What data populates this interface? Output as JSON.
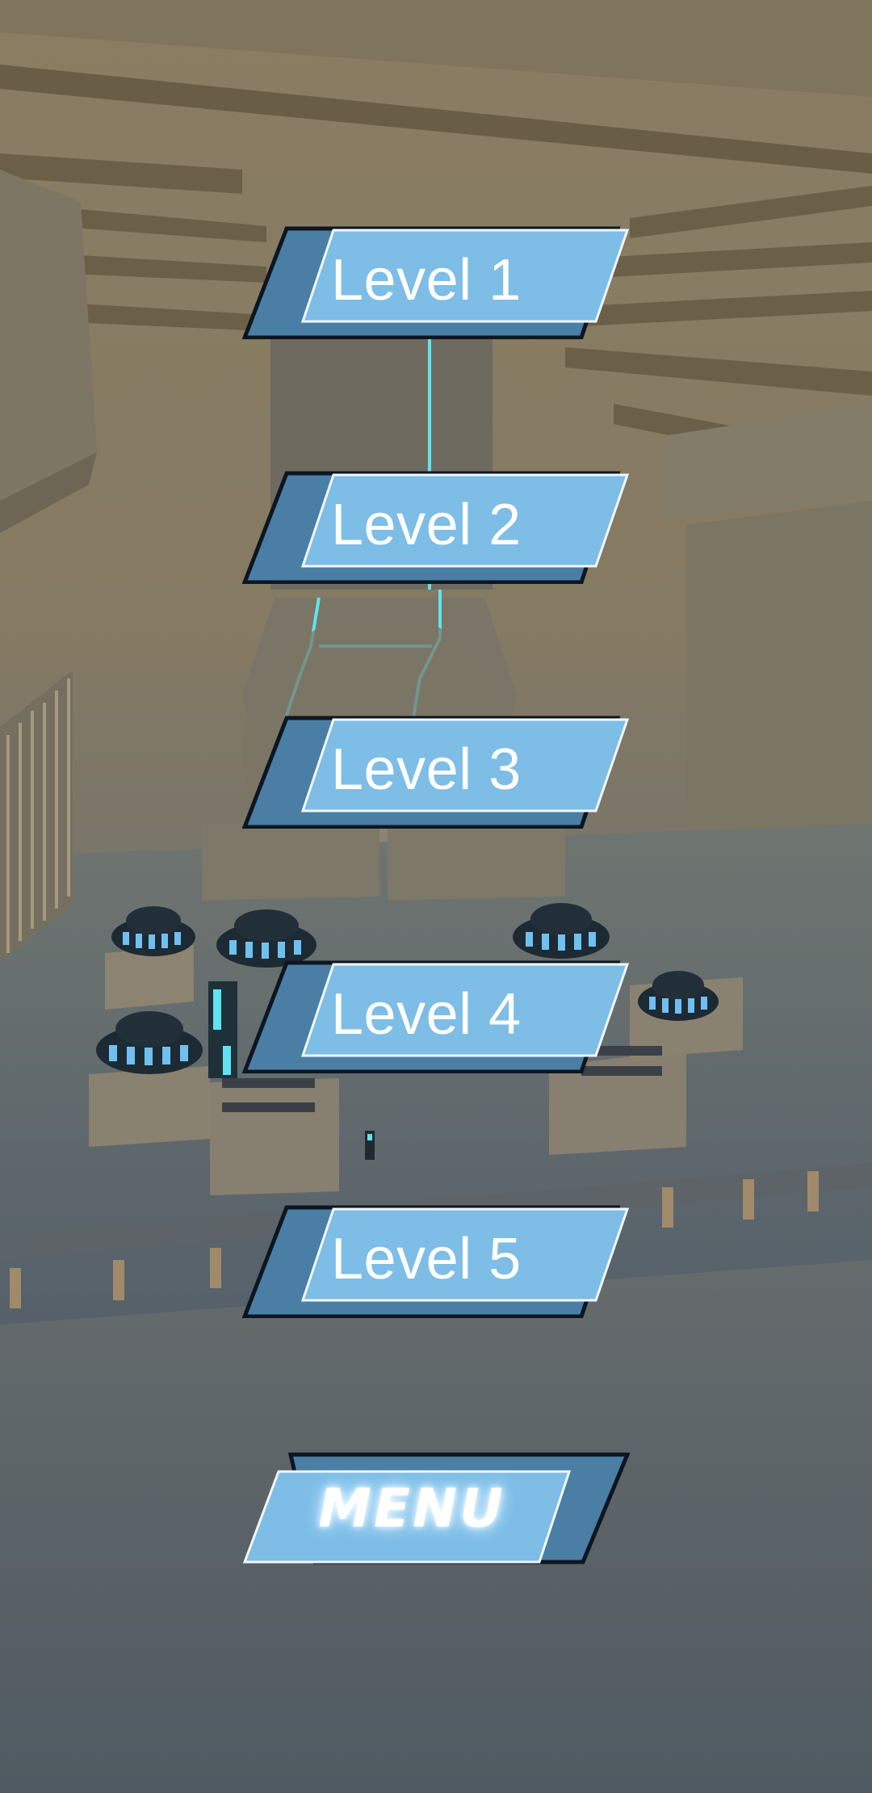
{
  "levels": [
    {
      "label": "Level 1"
    },
    {
      "label": "Level 2"
    },
    {
      "label": "Level 3"
    },
    {
      "label": "Level 4"
    },
    {
      "label": "Level 5"
    }
  ],
  "menu": {
    "label": "MENU"
  },
  "colors": {
    "button_light": "#7dbde6",
    "button_dark": "#4a7ea5",
    "button_outline": "#0d1620",
    "button_text": "#ffffff",
    "accent_glow": "#5fe3f0",
    "bg_top": "#8a7d62",
    "bg_bottom": "#4f5a62"
  }
}
